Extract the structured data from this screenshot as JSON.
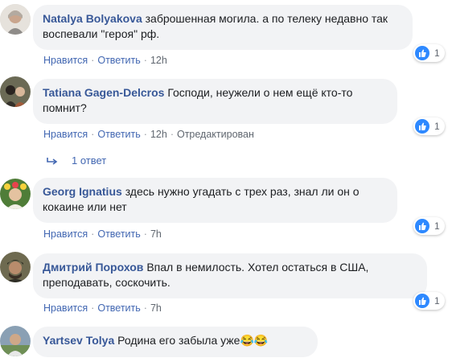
{
  "comments": [
    {
      "author": "Natalya Bolyakova",
      "text": "заброшенная могила. а по телеку недавно так воспевали \"героя\" рф.",
      "like": "Нравится",
      "reply": "Ответить",
      "time": "12h",
      "reactions": "1"
    },
    {
      "author": "Tatiana Gagen-Delcros",
      "text": "Господи, неужели о нем ещё кто-то помнит?",
      "like": "Нравится",
      "reply": "Ответить",
      "time": "12h",
      "edited": "Отредактирован",
      "reactions": "1",
      "replies": "1 ответ"
    },
    {
      "author": "Georg Ignatius",
      "text": "здесь нужно угадать с трех раз, знал ли он о кокаине или нет",
      "like": "Нравится",
      "reply": "Ответить",
      "time": "7h",
      "reactions": "1"
    },
    {
      "author": "Дмитрий Порохов",
      "text": "Впал в немилость. Хотел остаться в США, преподавать, соскочить.",
      "like": "Нравится",
      "reply": "Ответить",
      "time": "7h",
      "reactions": "1"
    },
    {
      "author": "Yartsev Tolya",
      "text": "Родина его забыла уже",
      "emoji": "😂😂"
    }
  ],
  "colors": {
    "link": "#385898",
    "action": "#4267b2",
    "bubble": "#f2f3f5",
    "like": "#2e89ff"
  },
  "icons": {
    "like": "thumbs-up-icon",
    "reply_arrow": "reply-arrow-icon"
  }
}
